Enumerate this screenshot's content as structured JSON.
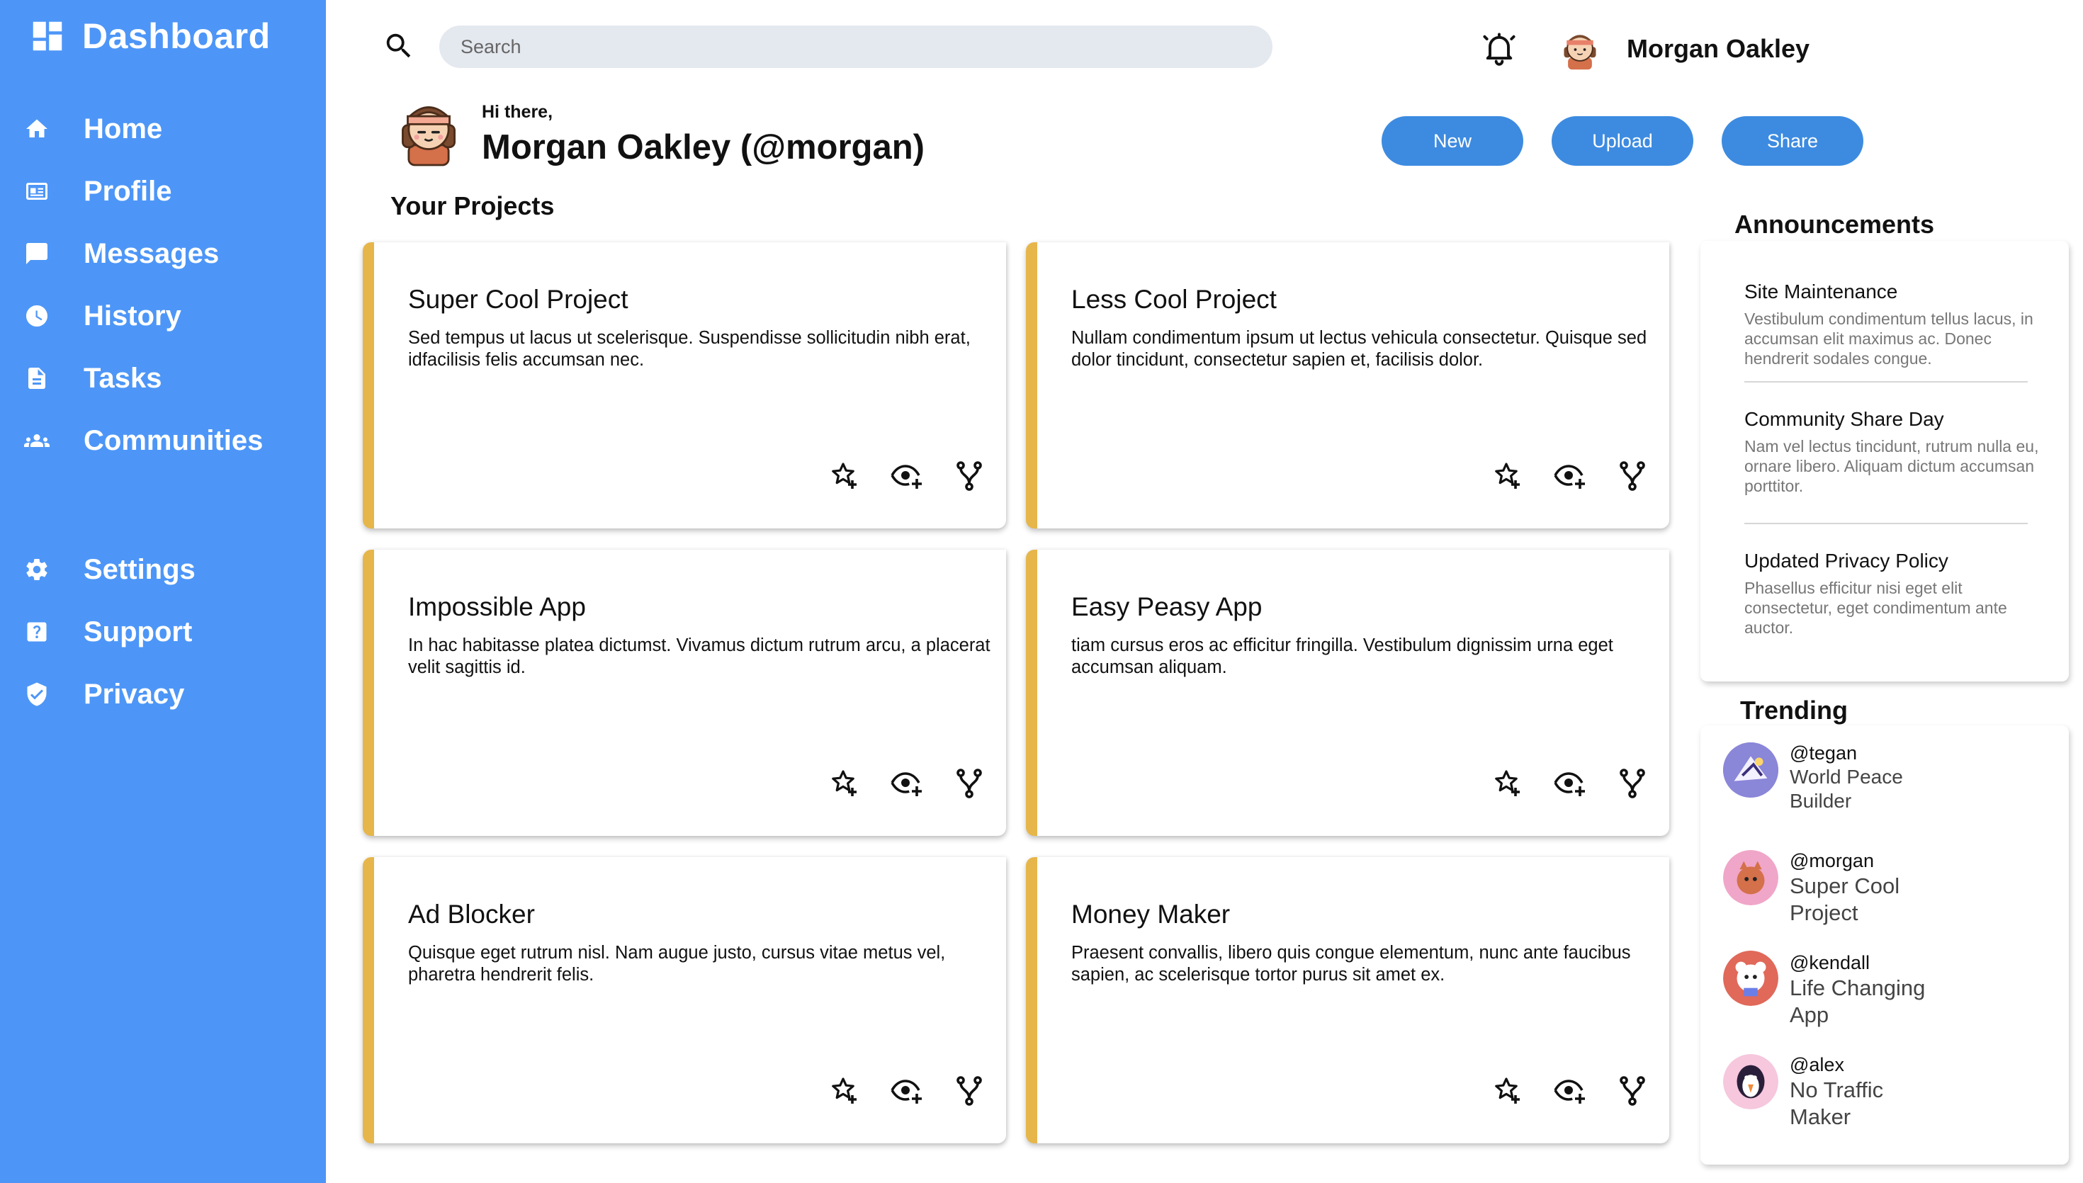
{
  "sidebar": {
    "title": "Dashboard",
    "items": [
      {
        "label": "Home",
        "icon": "home-icon"
      },
      {
        "label": "Profile",
        "icon": "id-card-icon"
      },
      {
        "label": "Messages",
        "icon": "message-icon"
      },
      {
        "label": "History",
        "icon": "clock-icon"
      },
      {
        "label": "Tasks",
        "icon": "document-icon"
      },
      {
        "label": "Communities",
        "icon": "people-icon"
      },
      {
        "label": "Settings",
        "icon": "gear-icon"
      },
      {
        "label": "Support",
        "icon": "help-icon"
      },
      {
        "label": "Privacy",
        "icon": "shield-icon"
      }
    ]
  },
  "header": {
    "search_placeholder": "Search",
    "user_name": "Morgan Oakley"
  },
  "greeting": {
    "hi": "Hi there,",
    "name": "Morgan Oakley (@morgan)"
  },
  "actions": {
    "new_label": "New",
    "upload_label": "Upload",
    "share_label": "Share"
  },
  "projects": {
    "title": "Your Projects",
    "items": [
      {
        "title": "Super Cool Project",
        "desc": "Sed tempus ut lacus ut scelerisque. Suspendisse sollicitudin nibh erat, idfacilisis felis accumsan nec."
      },
      {
        "title": "Less Cool Project",
        "desc": "Nullam condimentum ipsum ut lectus vehicula consectetur. Quisque sed dolor tincidunt, consectetur sapien et, facilisis dolor."
      },
      {
        "title": "Impossible App",
        "desc": "In hac habitasse platea dictumst. Vivamus dictum rutrum arcu, a placerat velit sagittis id."
      },
      {
        "title": "Easy Peasy App",
        "desc": "tiam cursus eros ac efficitur fringilla. Vestibulum dignissim urna eget accumsan aliquam."
      },
      {
        "title": "Ad Blocker",
        "desc": "Quisque eget rutrum nisl. Nam augue justo, cursus vitae metus vel, pharetra hendrerit felis."
      },
      {
        "title": "Money Maker",
        "desc": "Praesent convallis, libero quis congue elementum, nunc ante faucibus sapien, ac scelerisque tortor purus sit amet ex."
      }
    ]
  },
  "announcements": {
    "title": "Announcements",
    "items": [
      {
        "title": "Site Maintenance",
        "body": "Vestibulum condimentum tellus lacus, in accumsan elit maximus ac. Donec hendrerit sodales congue."
      },
      {
        "title": "Community Share Day",
        "body": "Nam vel lectus tincidunt, rutrum nulla eu, ornare libero. Aliquam dictum accumsan porttitor."
      },
      {
        "title": "Updated Privacy Policy",
        "body": "Phasellus efficitur nisi eget elit consectetur, eget condimentum ante auctor."
      }
    ]
  },
  "trending": {
    "title": "Trending",
    "items": [
      {
        "user": "@tegan",
        "project": "World Peace Builder"
      },
      {
        "user": "@morgan",
        "project": "Super Cool Project"
      },
      {
        "user": "@kendall",
        "project": "Life Changing App"
      },
      {
        "user": "@alex",
        "project": "No Traffic Maker"
      }
    ]
  },
  "colors": {
    "sidebar": "#4d96f7",
    "button": "#3d8be0",
    "card_accent": "#e7b64a"
  }
}
